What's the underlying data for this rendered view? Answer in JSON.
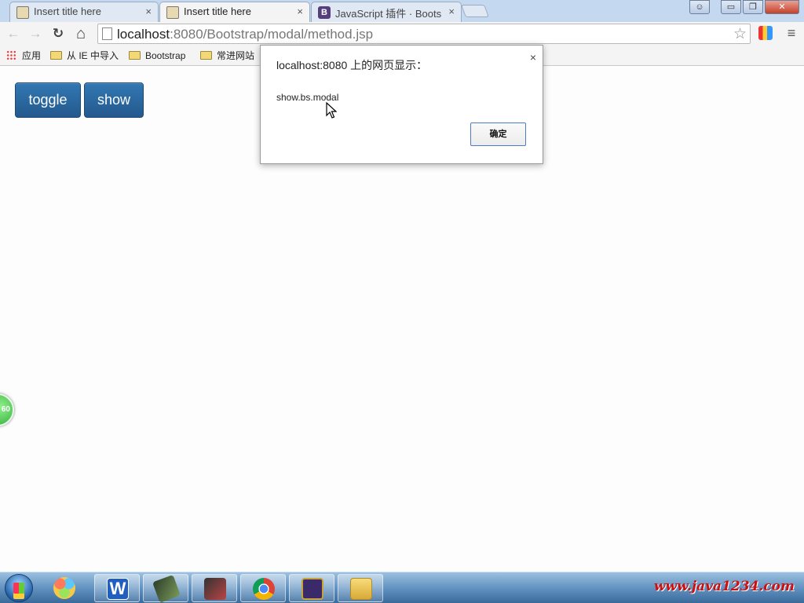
{
  "tabs": [
    {
      "title": "Insert title here",
      "close": "×"
    },
    {
      "title": "Insert title here",
      "close": "×"
    },
    {
      "title": "JavaScript 插件 · Boots",
      "close": "×",
      "favicon": "B"
    }
  ],
  "window_controls": {
    "minimize": "▭",
    "restore": "❐",
    "close": "✕",
    "user": "☺"
  },
  "toolbar": {
    "back": "←",
    "forward": "→",
    "reload": "↻",
    "home": "⌂",
    "url_host": "localhost",
    "url_path": ":8080/Bootstrap/modal/method.jsp",
    "star": "☆",
    "menu": "≡"
  },
  "bookmarks": {
    "apps": "应用",
    "items": [
      "从 IE 中导入",
      "Bootstrap",
      "常进网站"
    ]
  },
  "page": {
    "buttons": {
      "toggle": "toggle",
      "show": "show"
    },
    "orb_label": "60"
  },
  "dialog": {
    "title": "localhost:8080 上的网页显示：",
    "close": "×",
    "message": "show.bs.modal",
    "ok_label": "确定"
  },
  "taskbar": {
    "app_label": "W",
    "watermark": "www.java1234.com"
  },
  "colors": {
    "button_primary": "#24598d",
    "dialog_ok_border": "#4d7cc4",
    "watermark": "#cc1010"
  }
}
